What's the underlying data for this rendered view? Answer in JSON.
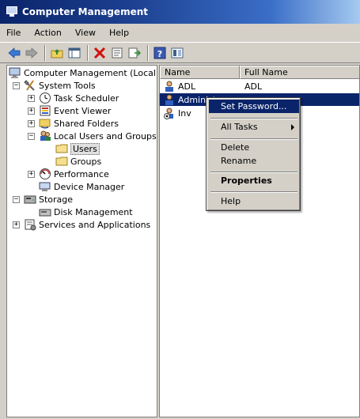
{
  "window": {
    "title": "Computer Management"
  },
  "menubar": {
    "items": [
      "File",
      "Action",
      "View",
      "Help"
    ]
  },
  "toolbar": {
    "icons": [
      "back-arrow-icon",
      "forward-arrow-icon",
      "up-folder-icon",
      "show-hide-tree-icon",
      "delete-icon",
      "properties-icon",
      "export-list-icon",
      "help-icon",
      "console-tree-icon"
    ]
  },
  "tree": {
    "root": "Computer Management (Local)",
    "system_tools": "System Tools",
    "task_scheduler": "Task Scheduler",
    "event_viewer": "Event Viewer",
    "shared_folders": "Shared Folders",
    "local_users_groups": "Local Users and Groups",
    "users": "Users",
    "groups": "Groups",
    "performance": "Performance",
    "device_manager": "Device Manager",
    "storage": "Storage",
    "disk_management": "Disk Management",
    "services_apps": "Services and Applications"
  },
  "list": {
    "columns": [
      "Name",
      "Full Name"
    ],
    "rows": [
      {
        "name": "ADL",
        "full_name": "ADL"
      },
      {
        "name": "Administ",
        "full_name": ""
      },
      {
        "name": "Inv",
        "full_name": ""
      }
    ]
  },
  "context_menu": {
    "set_password": "Set Password...",
    "all_tasks": "All Tasks",
    "delete": "Delete",
    "rename": "Rename",
    "properties": "Properties",
    "help": "Help"
  },
  "colors": {
    "title_bar": "#0a246a",
    "selection": "#0a246a",
    "chrome": "#d4d0c8"
  }
}
